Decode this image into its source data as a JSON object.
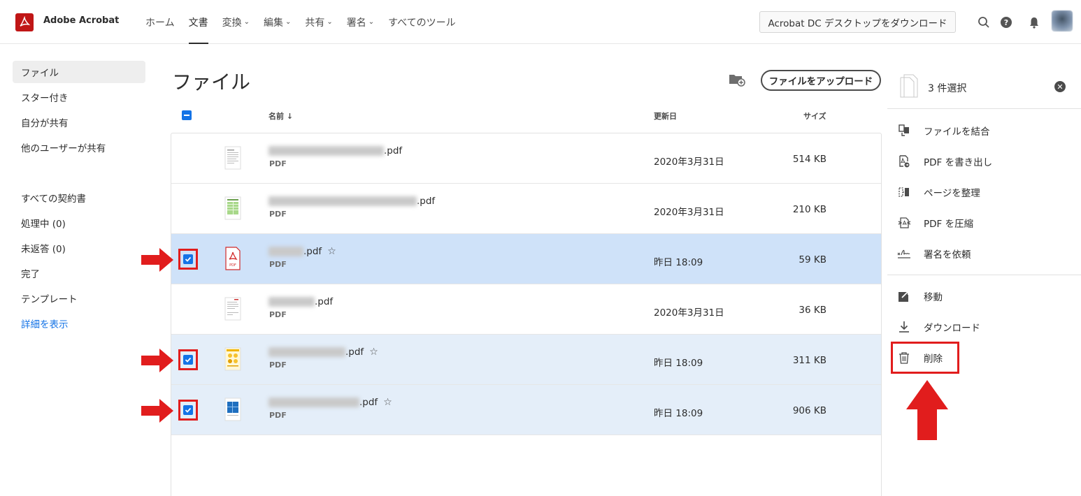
{
  "app": {
    "name": "Adobe Acrobat"
  },
  "nav": [
    {
      "label": "ホーム",
      "dropdown": false,
      "active": false
    },
    {
      "label": "文書",
      "dropdown": false,
      "active": true
    },
    {
      "label": "変換",
      "dropdown": true,
      "active": false
    },
    {
      "label": "編集",
      "dropdown": true,
      "active": false
    },
    {
      "label": "共有",
      "dropdown": true,
      "active": false
    },
    {
      "label": "署名",
      "dropdown": true,
      "active": false
    },
    {
      "label": "すべてのツール",
      "dropdown": false,
      "active": false
    }
  ],
  "header": {
    "download_label": "Acrobat DC デスクトップをダウンロード",
    "icons": [
      "search-icon",
      "help-icon",
      "bell-icon",
      "avatar"
    ]
  },
  "sidebar": {
    "group1": [
      {
        "label": "ファイル",
        "active": true
      },
      {
        "label": "スター付き",
        "active": false
      },
      {
        "label": "自分が共有",
        "active": false
      },
      {
        "label": "他のユーザーが共有",
        "active": false
      }
    ],
    "group2": [
      {
        "label": "すべての契約書"
      },
      {
        "label": "処理中 (0)"
      },
      {
        "label": "未返答 (0)"
      },
      {
        "label": "完了"
      },
      {
        "label": "テンプレート"
      }
    ],
    "more_link": "詳細を表示"
  },
  "main": {
    "title": "ファイル",
    "upload_label": "ファイルをアップロード",
    "columns": {
      "name": "名前 ↓",
      "modified": "更新日",
      "size": "サイズ"
    }
  },
  "files": [
    {
      "name_suffix": ".pdf",
      "type": "PDF",
      "date": "2020年3月31日",
      "size": "514 KB",
      "selected": false,
      "starred": false,
      "thumb": "doc"
    },
    {
      "name_suffix": ".pdf",
      "type": "PDF",
      "date": "2020年3月31日",
      "size": "210 KB",
      "selected": false,
      "starred": false,
      "thumb": "green"
    },
    {
      "name_suffix": ".pdf",
      "type": "PDF",
      "date": "昨日 18:09",
      "size": "59 KB",
      "selected": true,
      "starred": true,
      "thumb": "pdf"
    },
    {
      "name_suffix": ".pdf",
      "type": "PDF",
      "date": "2020年3月31日",
      "size": "36 KB",
      "selected": false,
      "starred": false,
      "thumb": "doc"
    },
    {
      "name_suffix": ".pdf",
      "type": "PDF",
      "date": "昨日 18:09",
      "size": "311 KB",
      "selected": true,
      "starred": true,
      "thumb": "yellow"
    },
    {
      "name_suffix": ".pdf",
      "type": "PDF",
      "date": "昨日 18:09",
      "size": "906 KB",
      "selected": true,
      "starred": true,
      "thumb": "blue"
    }
  ],
  "selection_panel": {
    "count_label": "3 件選択",
    "actions": [
      {
        "label": "ファイルを結合",
        "icon": "combine-icon"
      },
      {
        "label": "PDF を書き出し",
        "icon": "export-pdf-icon"
      },
      {
        "label": "ページを整理",
        "icon": "organize-pages-icon"
      },
      {
        "label": "PDF を圧縮",
        "icon": "compress-pdf-icon"
      },
      {
        "label": "署名を依頼",
        "icon": "request-signature-icon"
      }
    ],
    "actions2": [
      {
        "label": "移動",
        "icon": "move-icon"
      },
      {
        "label": "ダウンロード",
        "icon": "download-icon"
      },
      {
        "label": "削除",
        "icon": "trash-icon"
      }
    ]
  },
  "colors": {
    "accent": "#1473e6",
    "brand": "#c01616",
    "annotation": "#e11d1d",
    "selected_row": "#cfe2f9"
  }
}
